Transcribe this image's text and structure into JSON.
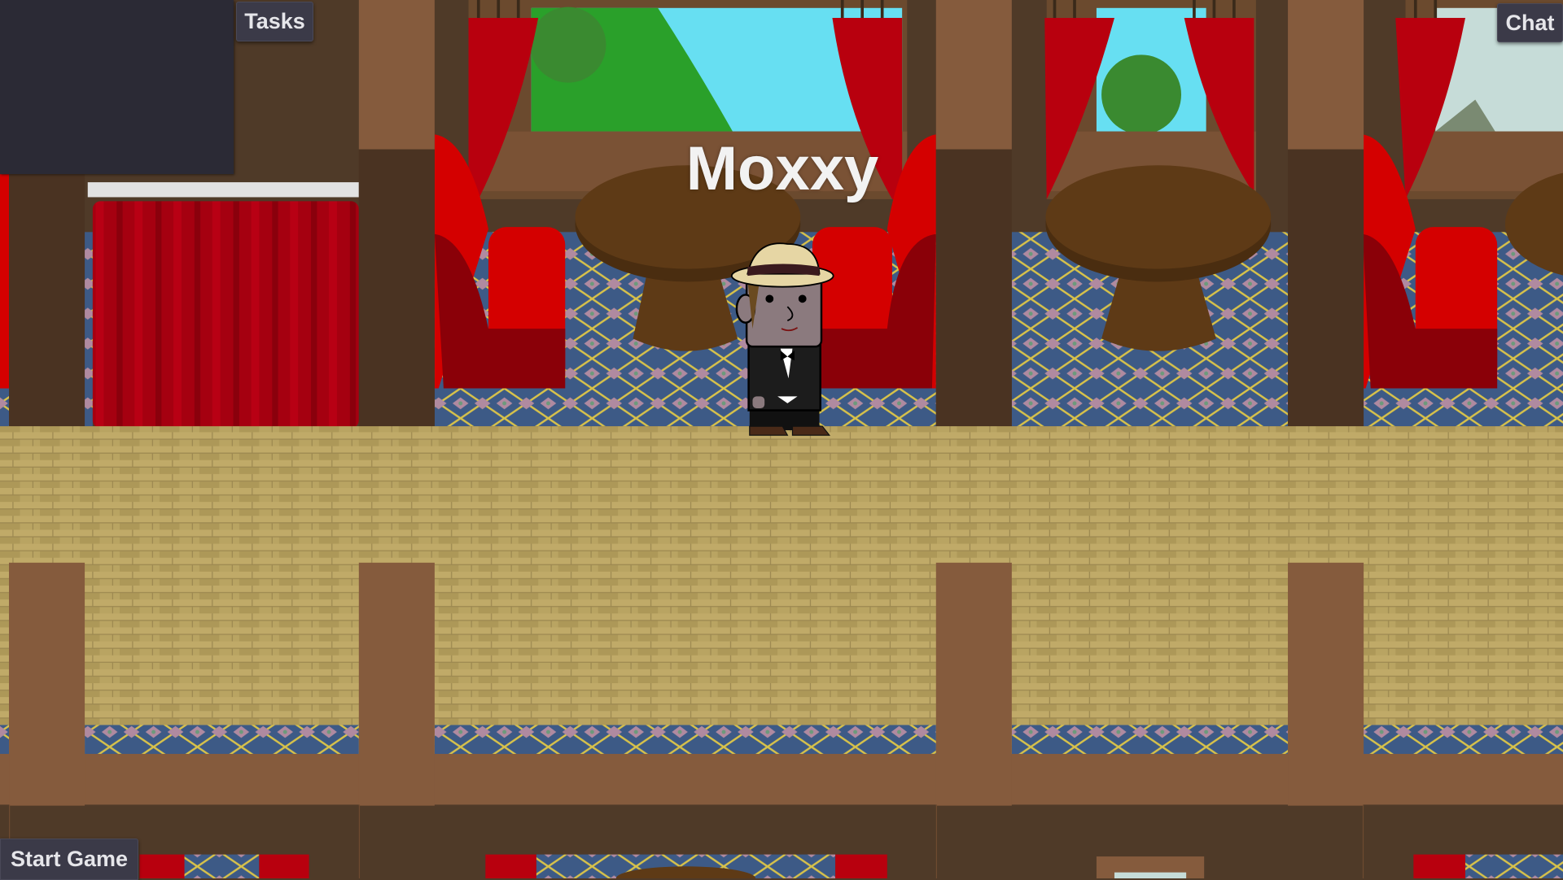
{
  "hud": {
    "tasks_label": "Tasks",
    "chat_label": "Chat",
    "start_game_label": "Start Game"
  },
  "player": {
    "name": "Moxxy"
  },
  "colors": {
    "wall_dark": "#4f3a28",
    "pillar": "#855b3d",
    "floor": "#b9a462",
    "carpet": "#3d5a86",
    "seat_red": "#d40000",
    "curtain_red": "#a50010",
    "table": "#5e3a16",
    "button_bg": "#3b3a48"
  }
}
